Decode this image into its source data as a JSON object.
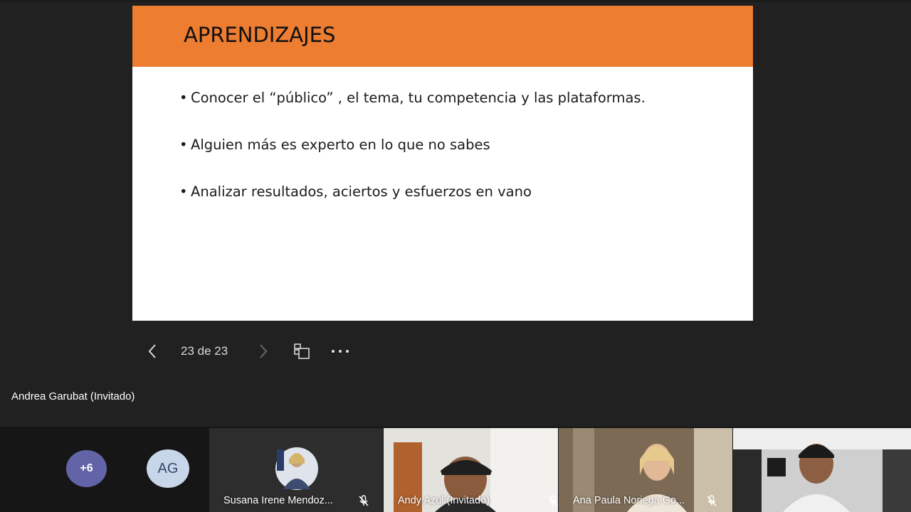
{
  "slide": {
    "title": "APRENDIZAJES",
    "bullets": [
      "Conocer el “público” , el tema, tu competencia y las plataformas.",
      "Alguien más es experto en lo que no sabes",
      "Analizar resultados, aciertos y esfuerzos en vano"
    ],
    "header_color": "#ed7d31"
  },
  "controls": {
    "counter": "23 de 23",
    "icons": [
      "chevron-left-icon",
      "chevron-right-icon",
      "slide-overview-icon",
      "more-options-icon"
    ]
  },
  "presenter": {
    "name": "Andrea Garubat (Invitado)"
  },
  "participants": {
    "overflow_label": "+6",
    "initials": "AG",
    "tiles": [
      {
        "name": "Susana Irene Mendoz...",
        "muted": true
      },
      {
        "name": "Andy Azul (Invitado)",
        "muted": true
      },
      {
        "name": "Ana Paula Noriega Go...",
        "muted": true
      },
      {
        "name": "",
        "muted": false
      }
    ],
    "accent_color": "#6264a7"
  }
}
